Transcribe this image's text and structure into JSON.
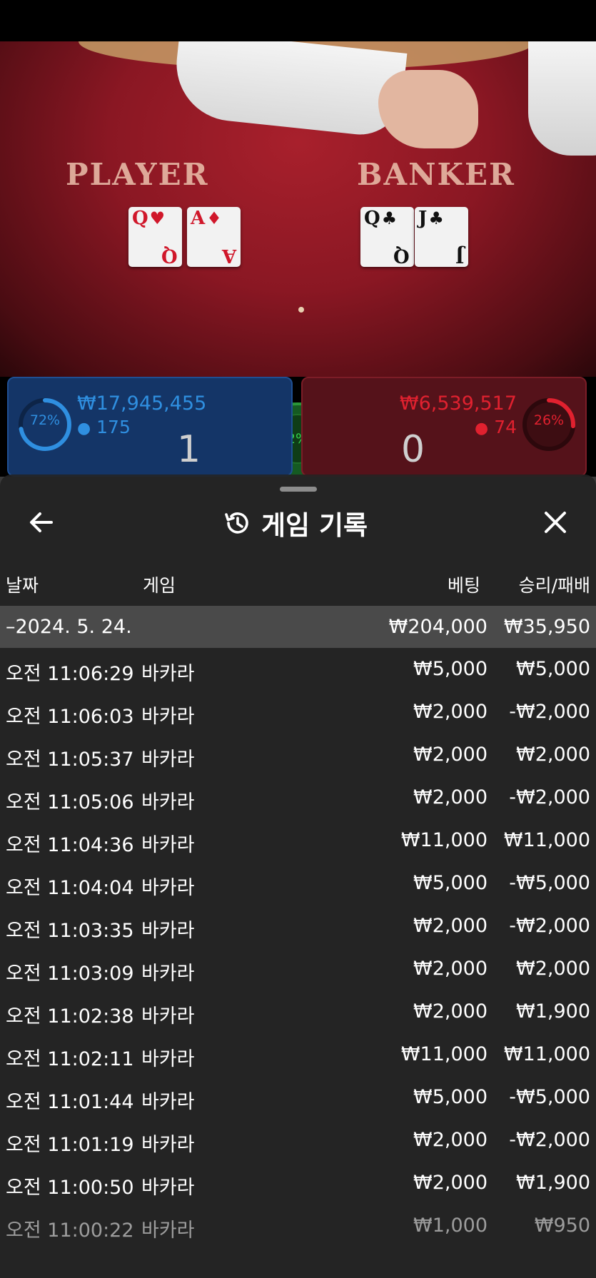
{
  "table": {
    "player_label": "PLAYER",
    "banker_label": "BANKER",
    "player_cards": [
      {
        "rank": "Q",
        "suit": "♥",
        "color": "red"
      },
      {
        "rank": "A",
        "suit": "♦",
        "color": "red"
      }
    ],
    "banker_cards": [
      {
        "rank": "Q",
        "suit": "♣",
        "color": "black"
      },
      {
        "rank": "J",
        "suit": "♣",
        "color": "black"
      }
    ]
  },
  "player_panel": {
    "percent": "72%",
    "percent_value": 72,
    "amount": "₩17,945,455",
    "count": "175",
    "score": "1"
  },
  "banker_panel": {
    "percent": "26%",
    "percent_value": 26,
    "amount": "₩6,539,517",
    "count": "74",
    "score": "0"
  },
  "tie_panel": {
    "percent": "2%",
    "percent_value": 2
  },
  "sheet": {
    "title": "게임 기록",
    "columns": {
      "date": "날짜",
      "game": "게임",
      "bet": "베팅",
      "result": "승리/패배"
    },
    "date_group": {
      "date": "–2024. 5. 24.",
      "bet": "₩204,000",
      "result": "₩35,950"
    },
    "rows": [
      {
        "time": "오전 11:06:29",
        "game": "바카라",
        "bet": "₩5,000",
        "result": "₩5,000"
      },
      {
        "time": "오전 11:06:03",
        "game": "바카라",
        "bet": "₩2,000",
        "result": "-₩2,000"
      },
      {
        "time": "오전 11:05:37",
        "game": "바카라",
        "bet": "₩2,000",
        "result": "₩2,000"
      },
      {
        "time": "오전 11:05:06",
        "game": "바카라",
        "bet": "₩2,000",
        "result": "-₩2,000"
      },
      {
        "time": "오전 11:04:36",
        "game": "바카라",
        "bet": "₩11,000",
        "result": "₩11,000"
      },
      {
        "time": "오전 11:04:04",
        "game": "바카라",
        "bet": "₩5,000",
        "result": "-₩5,000"
      },
      {
        "time": "오전 11:03:35",
        "game": "바카라",
        "bet": "₩2,000",
        "result": "-₩2,000"
      },
      {
        "time": "오전 11:03:09",
        "game": "바카라",
        "bet": "₩2,000",
        "result": "₩2,000"
      },
      {
        "time": "오전 11:02:38",
        "game": "바카라",
        "bet": "₩2,000",
        "result": "₩1,900"
      },
      {
        "time": "오전 11:02:11",
        "game": "바카라",
        "bet": "₩11,000",
        "result": "₩11,000"
      },
      {
        "time": "오전 11:01:44",
        "game": "바카라",
        "bet": "₩5,000",
        "result": "-₩5,000"
      },
      {
        "time": "오전 11:01:19",
        "game": "바카라",
        "bet": "₩2,000",
        "result": "-₩2,000"
      },
      {
        "time": "오전 11:00:50",
        "game": "바카라",
        "bet": "₩2,000",
        "result": "₩1,900"
      },
      {
        "time": "오전 11:00:22",
        "game": "바카라",
        "bet": "₩1,000",
        "result": "₩950"
      }
    ]
  },
  "colors": {
    "player": "#2f8fe0",
    "banker": "#e0212f",
    "tie": "#35d34f"
  },
  "icons": [
    "back-arrow-icon",
    "history-icon",
    "close-icon",
    "person-icon"
  ]
}
